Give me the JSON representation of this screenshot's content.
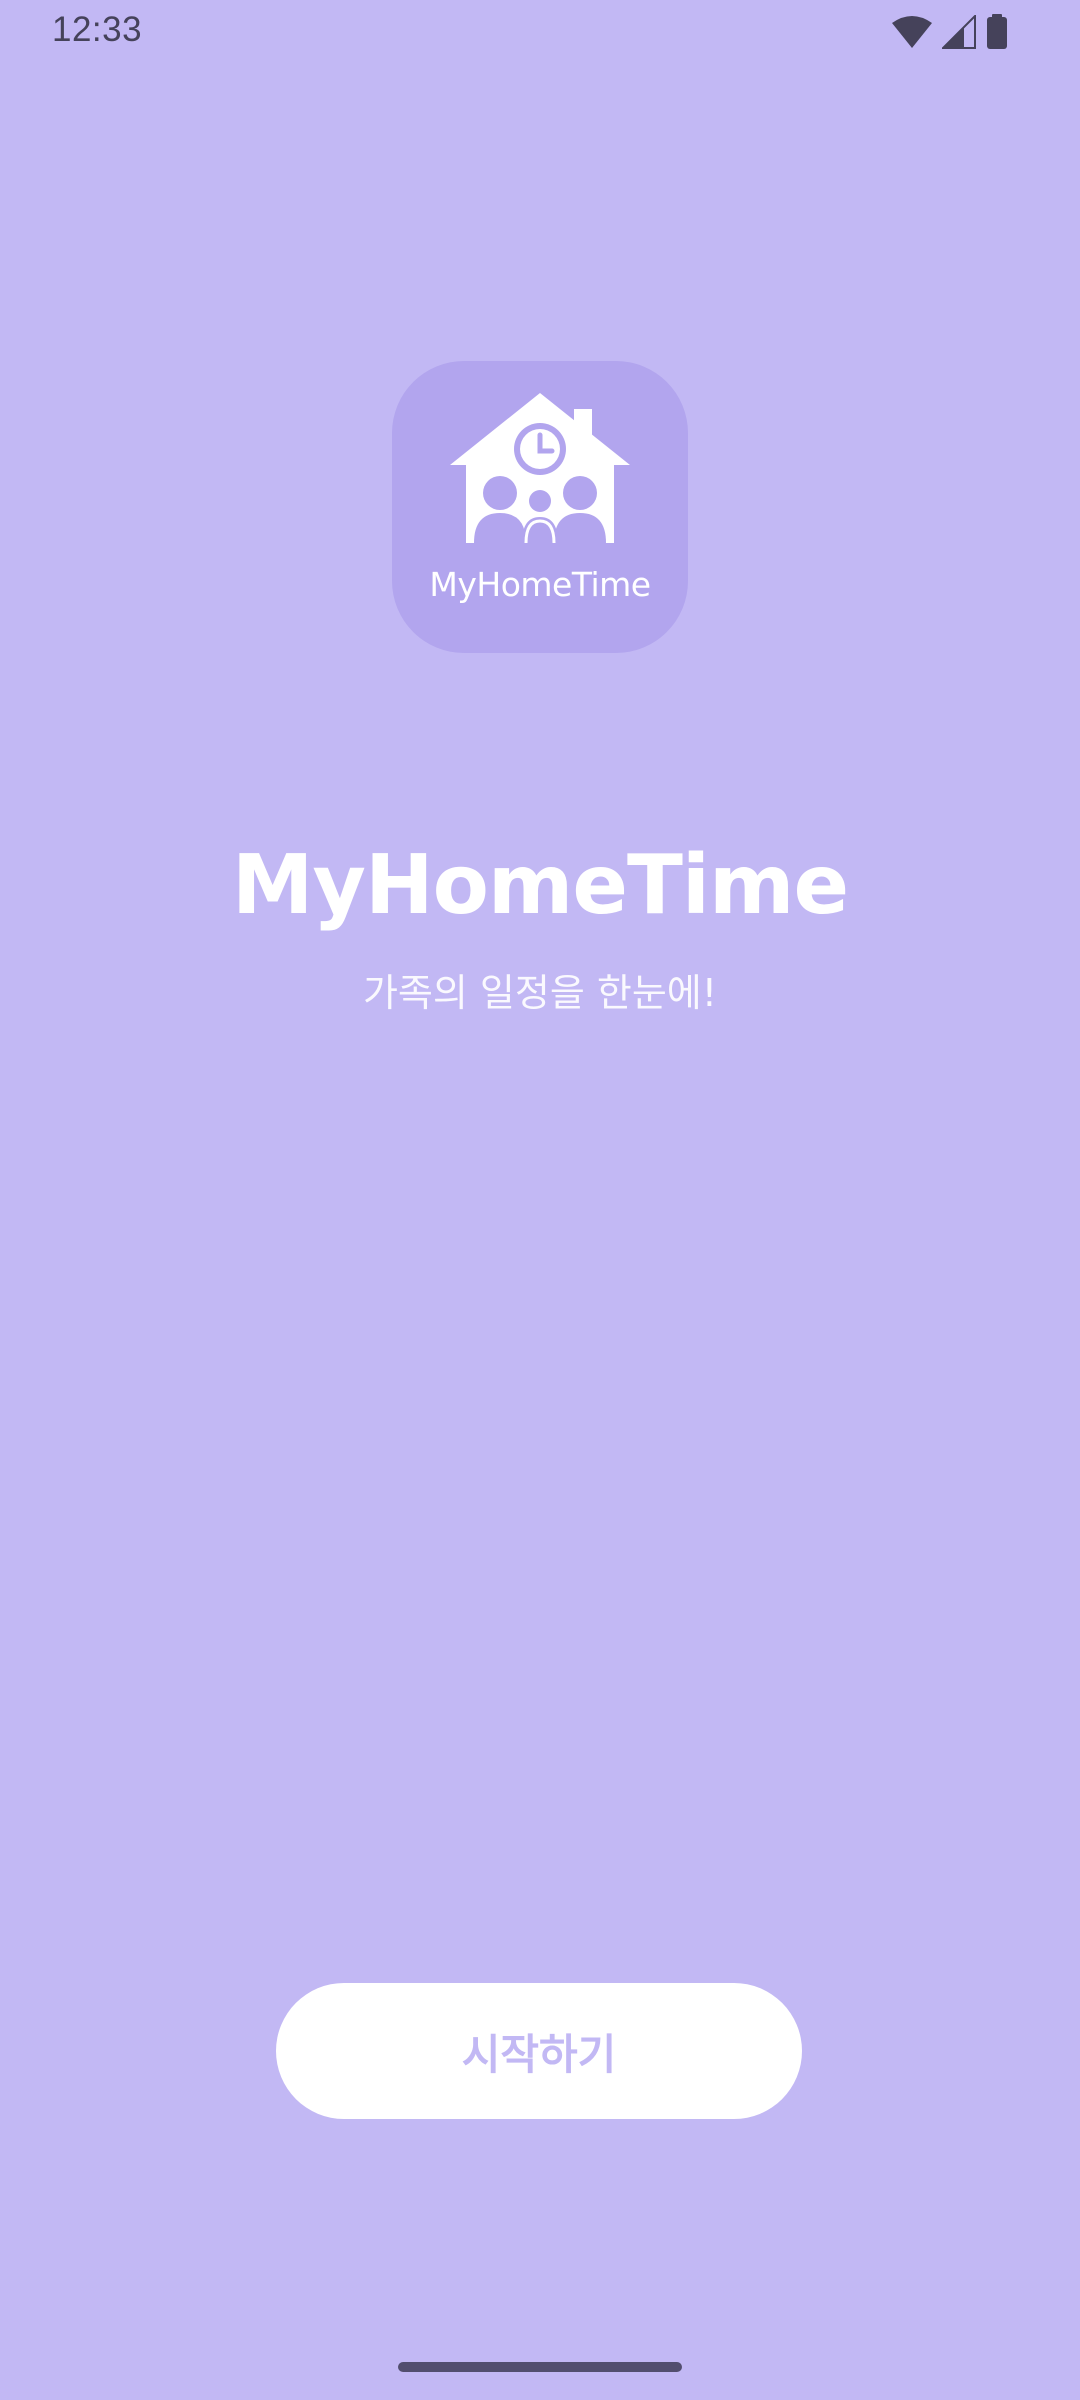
{
  "status_bar": {
    "time": "12:33",
    "icons": [
      "wifi-icon",
      "cell-signal-icon",
      "battery-icon"
    ]
  },
  "app_icon": {
    "label": "MyHomeTime",
    "symbol": "house-with-clock-and-family-icon"
  },
  "main": {
    "title": "MyHomeTime",
    "subtitle": "가족의 일정을 한눈에!"
  },
  "actions": {
    "start_label": "시작하기"
  },
  "colors": {
    "background": "#C2B8F4",
    "icon_tile": "#B2A5EE",
    "button": "#FFFFFF",
    "button_text": "#C2B8F4",
    "status_icons": "#45425A"
  }
}
